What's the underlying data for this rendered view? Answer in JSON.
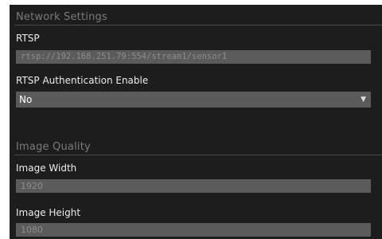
{
  "network_settings": {
    "title": "Network Settings",
    "rtsp": {
      "label": "RTSP",
      "value": "rtsp://192.168.251.79:554/stream1/sensor1"
    },
    "rtsp_auth": {
      "label": "RTSP Authentication Enable",
      "selected": "No",
      "arrow_icon": "chevron-down-icon"
    }
  },
  "image_quality": {
    "title": "Image Quality",
    "width": {
      "label": "Image Width",
      "value": "1920"
    },
    "height": {
      "label": "Image Height",
      "value": "1080"
    }
  },
  "colors": {
    "panel_bg": "#1d1d1d",
    "field_bg": "#5b5b5b",
    "section_title": "#7a7a7a",
    "label_text": "#ececec"
  }
}
